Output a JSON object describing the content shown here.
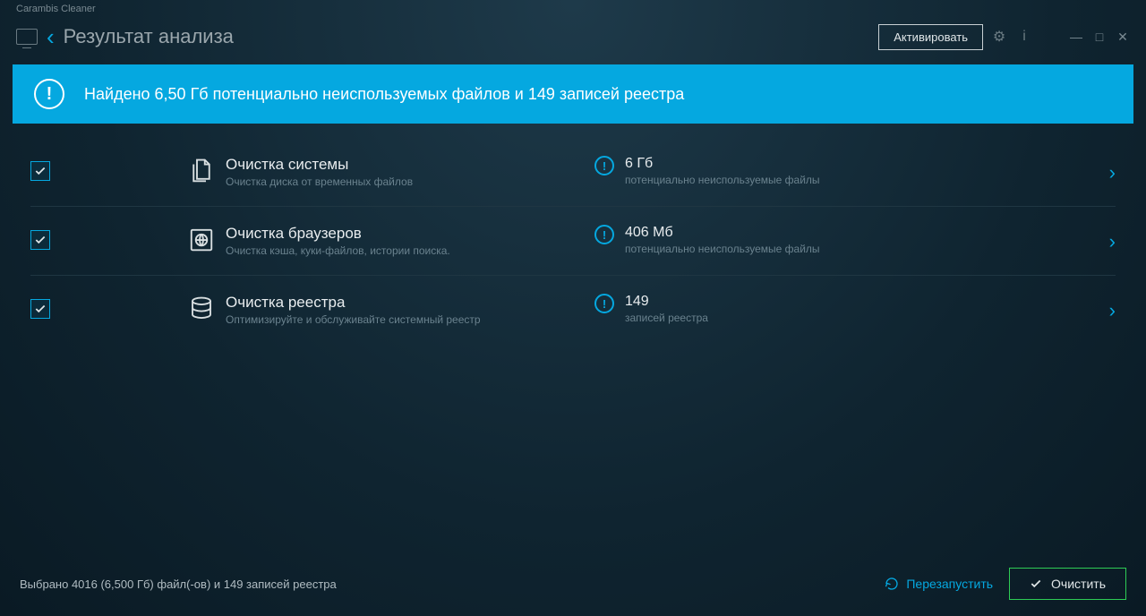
{
  "app_title": "Carambis Cleaner",
  "header": {
    "page_title": "Результат анализа",
    "activate_label": "Активировать"
  },
  "banner": {
    "text": "Найдено 6,50 Гб потенциально неиспользуемых файлов и 149 записей реестра"
  },
  "categories": [
    {
      "title": "Очистка системы",
      "subtitle": "Очистка диска от временных файлов",
      "value": "6 Гб",
      "value_sub": "потенциально неиспользуемые файлы"
    },
    {
      "title": "Очистка браузеров",
      "subtitle": "Очистка кэша, куки-файлов, истории поиска.",
      "value": "406 Мб",
      "value_sub": "потенциально неиспользуемые файлы"
    },
    {
      "title": "Очистка реестра",
      "subtitle": "Оптимизируйте и обслуживайте системный реестр",
      "value": "149",
      "value_sub": "записей реестра"
    }
  ],
  "footer": {
    "status": "Выбрано 4016 (6,500 Гб) файл(-ов) и 149 записей реестра",
    "restart_label": "Перезапустить",
    "clean_label": "Очистить"
  }
}
